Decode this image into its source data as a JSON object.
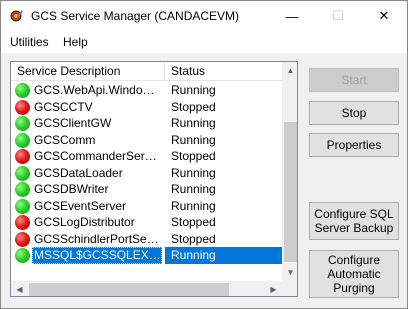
{
  "window": {
    "title": "GCS Service Manager (CANDACEVM)",
    "icon": "gear-wrench-icon",
    "minimize_glyph": "—",
    "maximize_glyph": "☐",
    "close_glyph": "✕"
  },
  "menu": {
    "items": [
      "Utilities",
      "Help"
    ]
  },
  "list": {
    "columns": [
      "Service Description",
      "Status"
    ],
    "rows": [
      {
        "description": "GCS.WebApi.WindowsS...",
        "status": "Running",
        "state": "running"
      },
      {
        "description": "GCSCCTV",
        "status": "Stopped",
        "state": "stopped"
      },
      {
        "description": "GCSClientGW",
        "status": "Running",
        "state": "running"
      },
      {
        "description": "GCSComm",
        "status": "Running",
        "state": "running"
      },
      {
        "description": "GCSCommanderService",
        "status": "Stopped",
        "state": "stopped"
      },
      {
        "description": "GCSDataLoader",
        "status": "Running",
        "state": "running"
      },
      {
        "description": "GCSDBWriter",
        "status": "Running",
        "state": "running"
      },
      {
        "description": "GCSEventServer",
        "status": "Running",
        "state": "running"
      },
      {
        "description": "GCSLogDistributor",
        "status": "Stopped",
        "state": "stopped"
      },
      {
        "description": "GCSSchindlerPortService",
        "status": "Stopped",
        "state": "stopped"
      },
      {
        "description": "MSSQL$GCSSQLEXPR...",
        "status": "Running",
        "state": "running",
        "selected": true
      }
    ],
    "status_colors": {
      "running": "#2fcf2f",
      "stopped": "#e51b1b"
    },
    "selection_color": "#0078d7"
  },
  "buttons": {
    "start": "Start",
    "stop": "Stop",
    "properties": "Properties",
    "configure_sql_line1": "Configure SQL",
    "configure_sql_line2": "Server Backup",
    "configure_purge_line1": "Configure",
    "configure_purge_line2": "Automatic",
    "configure_purge_line3": "Purging"
  }
}
